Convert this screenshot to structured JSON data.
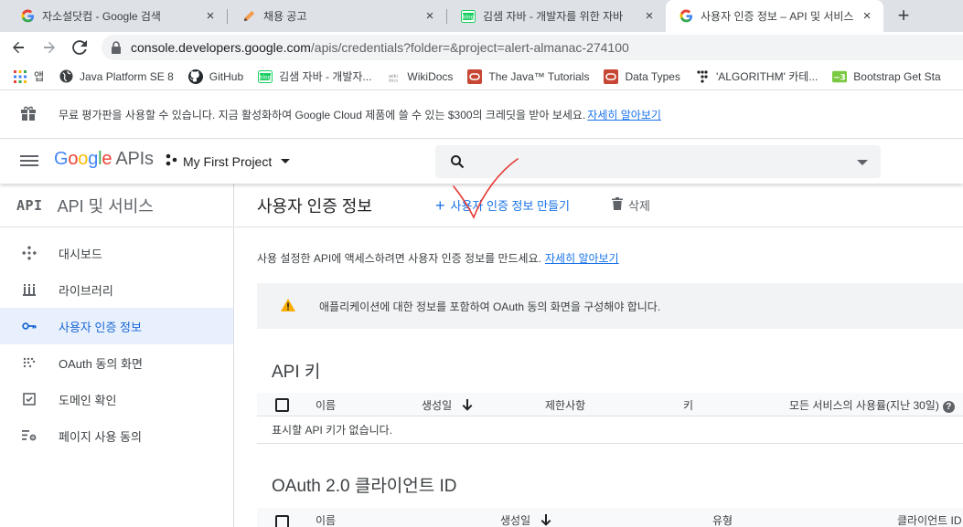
{
  "browser": {
    "tabs": [
      {
        "title": "자소설닷컴 - Google 검색",
        "favicon": "google-g-icon",
        "active": false
      },
      {
        "title": "채용 공고",
        "favicon": "pencil-icon",
        "active": false
      },
      {
        "title": "김샘 자바 - 개발자를 위한 자바",
        "favicon": "blog-icon",
        "active": false
      },
      {
        "title": "사용자 인증 정보 – API 및 서비스",
        "favicon": "google-g-icon",
        "active": true
      }
    ],
    "close_glyph": "×",
    "new_tab_glyph": "+",
    "url_host": "console.developers.google.com",
    "url_path": "/apis/credentials?folder=&project=alert-almanac-274100"
  },
  "bookmarks": [
    {
      "label": "앱",
      "icon": "apps-grid-icon"
    },
    {
      "label": "Java Platform SE 8",
      "icon": "globe-icon"
    },
    {
      "label": "GitHub",
      "icon": "github-icon"
    },
    {
      "label": "김샘 자바 - 개발자...",
      "icon": "blog-icon"
    },
    {
      "label": "WikiDocs",
      "icon": "wikidocs-icon"
    },
    {
      "label": "The Java™ Tutorials",
      "icon": "oracle-icon"
    },
    {
      "label": "Data Types",
      "icon": "oracle-icon"
    },
    {
      "label": "'ALGORITHM' 카테...",
      "icon": "dots-icon"
    },
    {
      "label": "Bootstrap Get Sta",
      "icon": "bootstrap-icon"
    }
  ],
  "promo": {
    "text": "무료 평가판을 사용할 수 있습니다. 지금 활성화하여 Google Cloud 제품에 쓸 수 있는 $300의 크레딧을 받아 보세요.",
    "link": "자세히 알아보기"
  },
  "header": {
    "logo_google": "Google",
    "logo_apis": "APIs",
    "project_name": "My First Project",
    "search_placeholder": ""
  },
  "sidebar": {
    "icon_text": "API",
    "title": "API 및 서비스",
    "items": [
      {
        "label": "대시보드",
        "icon": "dashboard-icon",
        "active": false
      },
      {
        "label": "라이브러리",
        "icon": "library-icon",
        "active": false
      },
      {
        "label": "사용자 인증 정보",
        "icon": "key-icon",
        "active": true
      },
      {
        "label": "OAuth 동의 화면",
        "icon": "oauth-dots-icon",
        "active": false
      },
      {
        "label": "도메인 확인",
        "icon": "checkbox-icon",
        "active": false
      },
      {
        "label": "페이지 사용 동의",
        "icon": "settings-list-icon",
        "active": false
      }
    ]
  },
  "main": {
    "page_title": "사용자 인증 정보",
    "create_label": "사용자 인증 정보 만들기",
    "delete_label": "삭제",
    "intro_text": "사용 설정한 API에 액세스하려면 사용자 인증 정보를 만드세요.",
    "intro_link": "자세히 알아보기",
    "warning_text": "애플리케이션에 대한 정보를 포함하여 OAuth 동의 화면을 구성해야 합니다.",
    "api_keys": {
      "title": "API 키",
      "columns": [
        "이름",
        "생성일",
        "제한사항",
        "키",
        "모든 서비스의 사용률(지난 30일)"
      ],
      "empty_text": "표시할 API 키가 없습니다."
    },
    "oauth": {
      "title": "OAuth 2.0 클라이언트 ID",
      "columns": [
        "이름",
        "생성일",
        "유형",
        "클라이언트 ID"
      ]
    }
  },
  "colors": {
    "accent": "#1a73e8",
    "active_bg": "#e8f0fe",
    "warning": "#f9ab00",
    "annotation": "#e53935"
  }
}
